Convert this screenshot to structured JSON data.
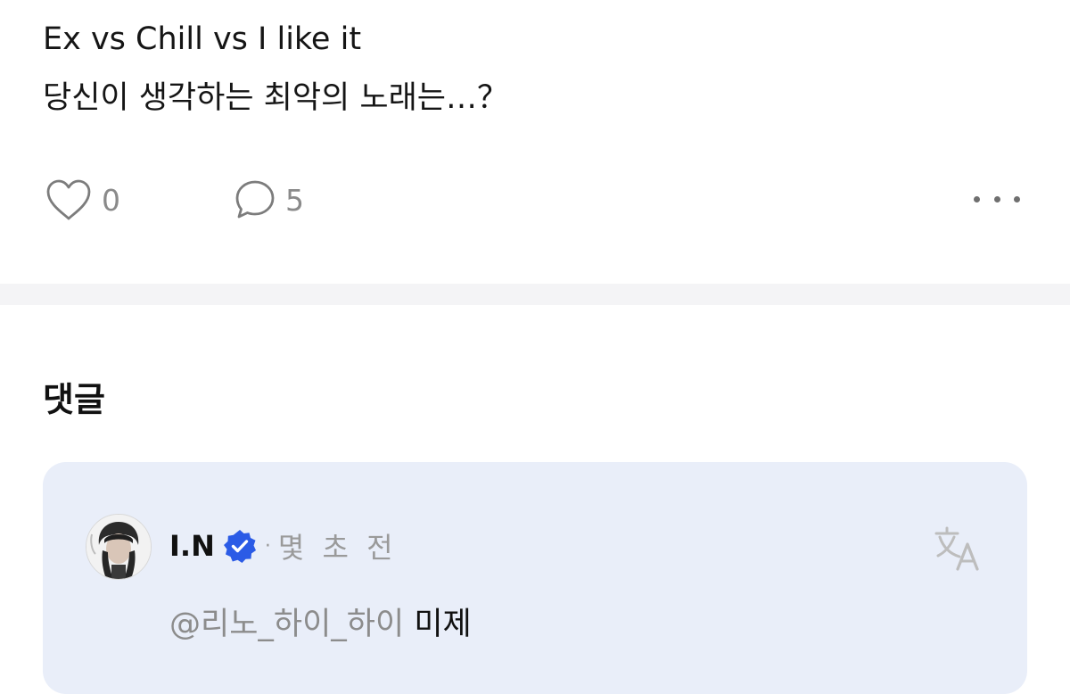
{
  "post": {
    "line1": "Ex vs Chill vs I like it",
    "line2": "당신이 생각하는 최악의 노래는…？"
  },
  "actions": {
    "like_count": "0",
    "comment_count": "5"
  },
  "comments_section": {
    "title": "댓글"
  },
  "comment": {
    "author": "I.N",
    "separator": "·",
    "time": "몇 초 전",
    "mention": "@리노_하이_하이",
    "text": " 미제"
  },
  "colors": {
    "card_background": "#e9eef9",
    "verified_badge": "#2b5be6",
    "muted_text": "#8c8c8c"
  },
  "icons": [
    "heart-icon",
    "comment-bubble-icon",
    "more-icon",
    "verified-badge-icon",
    "translate-icon"
  ]
}
